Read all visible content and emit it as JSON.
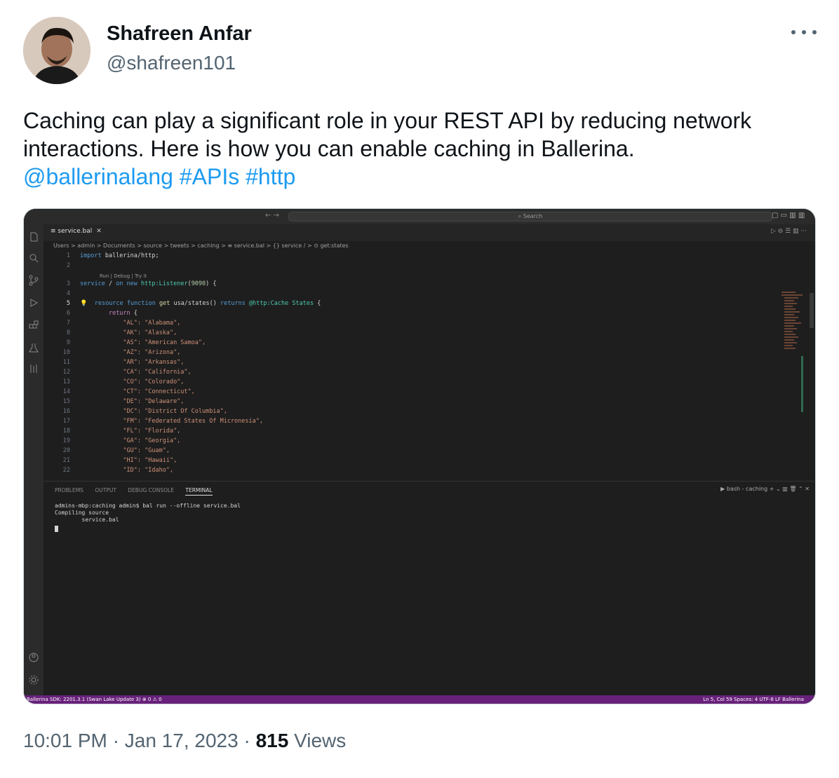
{
  "author": {
    "name": "Shafreen Anfar",
    "handle": "@shafreen101",
    "avatar_icon": "user-avatar-photo"
  },
  "more_icon": "more-horizontal-icon",
  "tweet": {
    "line1": "Caching can play a significant role in your REST API by reducing network",
    "line2": "interactions. Here is how you can enable caching in Ballerina.",
    "mention": "@ballerinalang",
    "hashtags": [
      "#APIs",
      "#http"
    ],
    "link_color": "#1d9bf0"
  },
  "screenshot": {
    "search_placeholder": "Search",
    "tab_name": "service.bal",
    "breadcrumb": "Users > admin > Documents > source > tweets > caching > ≡ service.bal > {} service / > ⊙ get:states",
    "codelens": "Run | Debug | Try it",
    "code": [
      {
        "n": "1",
        "t": "import ballerina/http;"
      },
      {
        "n": "2",
        "t": ""
      },
      {
        "n": "3",
        "t": "service / on new http:Listener(9090) {"
      },
      {
        "n": "4",
        "t": ""
      },
      {
        "n": "5",
        "t": "    resource function get usa/states() returns @http:Cache States {"
      },
      {
        "n": "6",
        "t": "        return {"
      },
      {
        "n": "7",
        "t": "            \"AL\": \"Alabama\","
      },
      {
        "n": "8",
        "t": "            \"AK\": \"Alaska\","
      },
      {
        "n": "9",
        "t": "            \"AS\": \"American Samoa\","
      },
      {
        "n": "10",
        "t": "            \"AZ\": \"Arizona\","
      },
      {
        "n": "11",
        "t": "            \"AR\": \"Arkansas\","
      },
      {
        "n": "12",
        "t": "            \"CA\": \"California\","
      },
      {
        "n": "13",
        "t": "            \"CO\": \"Colorado\","
      },
      {
        "n": "14",
        "t": "            \"CT\": \"Connecticut\","
      },
      {
        "n": "15",
        "t": "            \"DE\": \"Delaware\","
      },
      {
        "n": "16",
        "t": "            \"DC\": \"District Of Columbia\","
      },
      {
        "n": "17",
        "t": "            \"FM\": \"Federated States Of Micronesia\","
      },
      {
        "n": "18",
        "t": "            \"FL\": \"Florida\","
      },
      {
        "n": "19",
        "t": "            \"GA\": \"Georgia\","
      },
      {
        "n": "20",
        "t": "            \"GU\": \"Guam\","
      },
      {
        "n": "21",
        "t": "            \"HI\": \"Hawaii\","
      },
      {
        "n": "22",
        "t": "            \"ID\": \"Idaho\","
      }
    ],
    "panel_tabs": [
      "PROBLEMS",
      "OUTPUT",
      "DEBUG CONSOLE",
      "TERMINAL"
    ],
    "active_panel_tab": "TERMINAL",
    "terminal_name": "bash - caching",
    "terminal_lines": [
      "admins-mbp:caching admin$ bal run --offline service.bal",
      "Compiling source",
      "        service.bal"
    ],
    "status_left": "Ballerina SDK: 2201.3.1 (Swan Lake Update 3)   ⊗ 0 ⚠ 0",
    "status_right": "Ln 5, Col 59   Spaces: 4   UTF-8   LF   Ballerina",
    "statusbar_color": "#68217a"
  },
  "meta": {
    "time": "10:01 PM",
    "separator": "·",
    "date": "Jan 17, 2023",
    "views_count": "815",
    "views_label": "Views"
  }
}
